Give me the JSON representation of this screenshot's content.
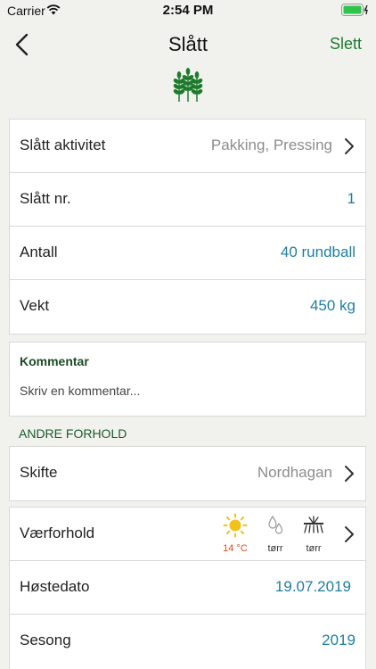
{
  "status_bar": {
    "carrier": "Carrier",
    "time": "2:54 PM"
  },
  "nav": {
    "title": "Slått",
    "delete_label": "Slett"
  },
  "details": {
    "activity": {
      "label": "Slått aktivitet",
      "value": "Pakking, Pressing"
    },
    "number": {
      "label": "Slått nr.",
      "value": "1"
    },
    "count": {
      "label": "Antall",
      "value": "40 rundball"
    },
    "weight": {
      "label": "Vekt",
      "value": "450 kg"
    }
  },
  "comment": {
    "title": "Kommentar",
    "placeholder": "Skriv en kommentar..."
  },
  "other_conditions": {
    "header": "ANDRE FORHOLD",
    "field": {
      "label": "Skifte",
      "value": "Nordhagan"
    },
    "weather": {
      "label": "Værforhold",
      "temperature": "14 °C",
      "precipitation": "tørr",
      "ground": "tørr",
      "colors": {
        "sun": "#f2c21b",
        "temperature": "#d84a22"
      }
    },
    "harvest_date": {
      "label": "Høstedato",
      "value": "19.07.2019"
    },
    "season": {
      "label": "Sesong",
      "value": "2019"
    }
  },
  "colors": {
    "accent_green": "#1e7b2d",
    "value_blue": "#1f7ea0",
    "background": "#f1f2ee"
  }
}
